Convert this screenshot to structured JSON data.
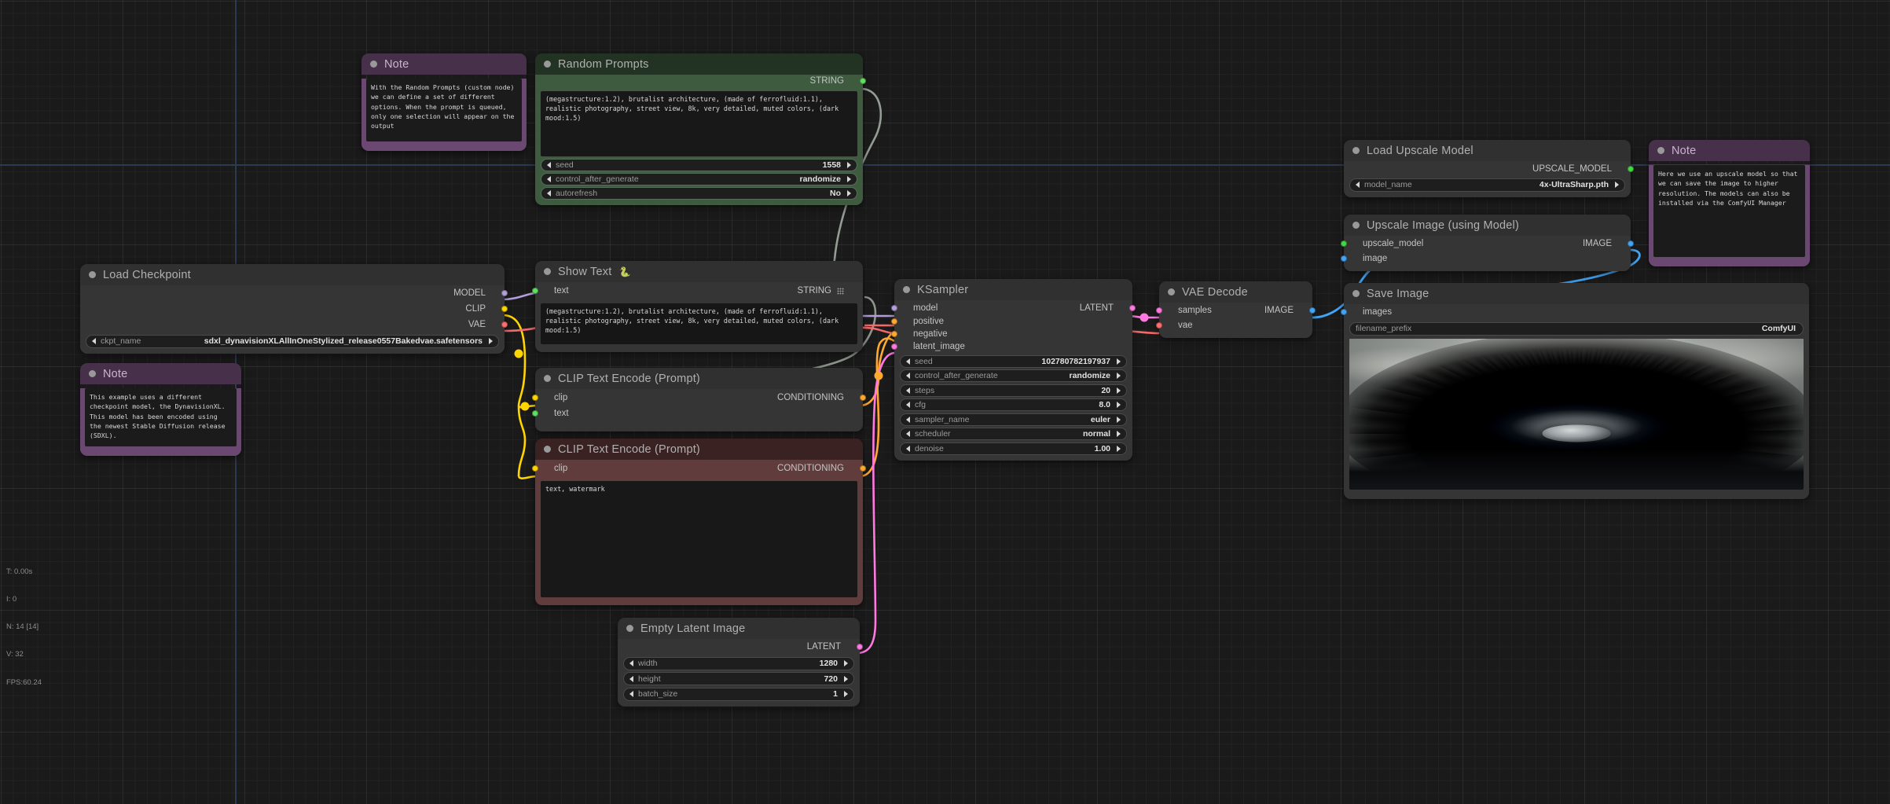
{
  "app": {
    "name": "ComfyUI",
    "canvas_background": "#1a1a1a"
  },
  "stats": {
    "time": "T: 0.00s",
    "iterations": "I: 0",
    "nodes": "N: 14 [14]",
    "vertices": "V: 32",
    "fps": "FPS:60.24"
  },
  "socket_colors": {
    "MODEL": "#b39ddb",
    "CLIP": "#ffd500",
    "VAE": "#ff6e6e",
    "CONDITIONING": "#ffa931",
    "LATENT": "#ff79e1",
    "IMAGE": "#64b5f6",
    "STRING": "#60e060",
    "UPSCALE_MODEL": "#44d844"
  },
  "nodes": {
    "note_random_prompts": {
      "title": "Note",
      "text": "With the Random Prompts (custom node) we can define a set of different options. When the prompt is queued, only one selection will appear on the output"
    },
    "random_prompts": {
      "title": "Random Prompts",
      "output_label": "STRING",
      "prompt_text": "(megastructure:1.2), brutalist architecture, (made of ferrofluid:1.1), realistic photography, street view, 8k, very detailed, muted colors, (dark mood:1.5)",
      "widgets": [
        {
          "name": "seed",
          "value": "1558"
        },
        {
          "name": "control_after_generate",
          "value": "randomize"
        },
        {
          "name": "autorefresh",
          "value": "No"
        }
      ]
    },
    "show_text": {
      "title": "Show Text",
      "title_emoji": "🐍",
      "input_label": "text",
      "output_label": "STRING",
      "text": "(megastructure:1.2), brutalist architecture, (made of ferrofluid:1.1), realistic photography, street view, 8k, very detailed, muted colors, (dark mood:1.5)"
    },
    "load_checkpoint": {
      "title": "Load Checkpoint",
      "outputs": [
        "MODEL",
        "CLIP",
        "VAE"
      ],
      "widgets": [
        {
          "name": "ckpt_name",
          "value": "sdxl_dynavisionXLAllInOneStylized_release0557Bakedvae.safetensors"
        }
      ]
    },
    "note_checkpoint": {
      "title": "Note",
      "text": "This example uses a different checkpoint model, the DynavisionXL. This model has been encoded using the newest Stable Diffusion release (SDXL)."
    },
    "clip_text_encode_positive": {
      "title": "CLIP Text Encode (Prompt)",
      "inputs": [
        "clip",
        "text"
      ],
      "output_label": "CONDITIONING"
    },
    "clip_text_encode_negative": {
      "title": "CLIP Text Encode (Prompt)",
      "inputs": [
        "clip"
      ],
      "output_label": "CONDITIONING",
      "text": "text, watermark"
    },
    "empty_latent_image": {
      "title": "Empty Latent Image",
      "output_label": "LATENT",
      "widgets": [
        {
          "name": "width",
          "value": "1280"
        },
        {
          "name": "height",
          "value": "720"
        },
        {
          "name": "batch_size",
          "value": "1"
        }
      ]
    },
    "ksampler": {
      "title": "KSampler",
      "inputs": [
        "model",
        "positive",
        "negative",
        "latent_image"
      ],
      "output_label": "LATENT",
      "widgets": [
        {
          "name": "seed",
          "value": "102780782197937"
        },
        {
          "name": "control_after_generate",
          "value": "randomize"
        },
        {
          "name": "steps",
          "value": "20"
        },
        {
          "name": "cfg",
          "value": "8.0"
        },
        {
          "name": "sampler_name",
          "value": "euler"
        },
        {
          "name": "scheduler",
          "value": "normal"
        },
        {
          "name": "denoise",
          "value": "1.00"
        }
      ]
    },
    "vae_decode": {
      "title": "VAE Decode",
      "inputs": [
        "samples",
        "vae"
      ],
      "output_label": "IMAGE"
    },
    "load_upscale_model": {
      "title": "Load Upscale Model",
      "output_label": "UPSCALE_MODEL",
      "widgets": [
        {
          "name": "model_name",
          "value": "4x-UltraSharp.pth"
        }
      ]
    },
    "upscale_image": {
      "title": "Upscale Image (using Model)",
      "inputs": [
        "upscale_model",
        "image"
      ],
      "output_label": "IMAGE"
    },
    "note_upscale": {
      "title": "Note",
      "text": "Here we use an upscale model so that we can save the image to higher resolution. The models can also be installed via the ComfyUI Manager"
    },
    "save_image": {
      "title": "Save Image",
      "input_label": "images",
      "widgets": [
        {
          "name": "filename_prefix",
          "value": "ComfyUI"
        }
      ]
    }
  }
}
